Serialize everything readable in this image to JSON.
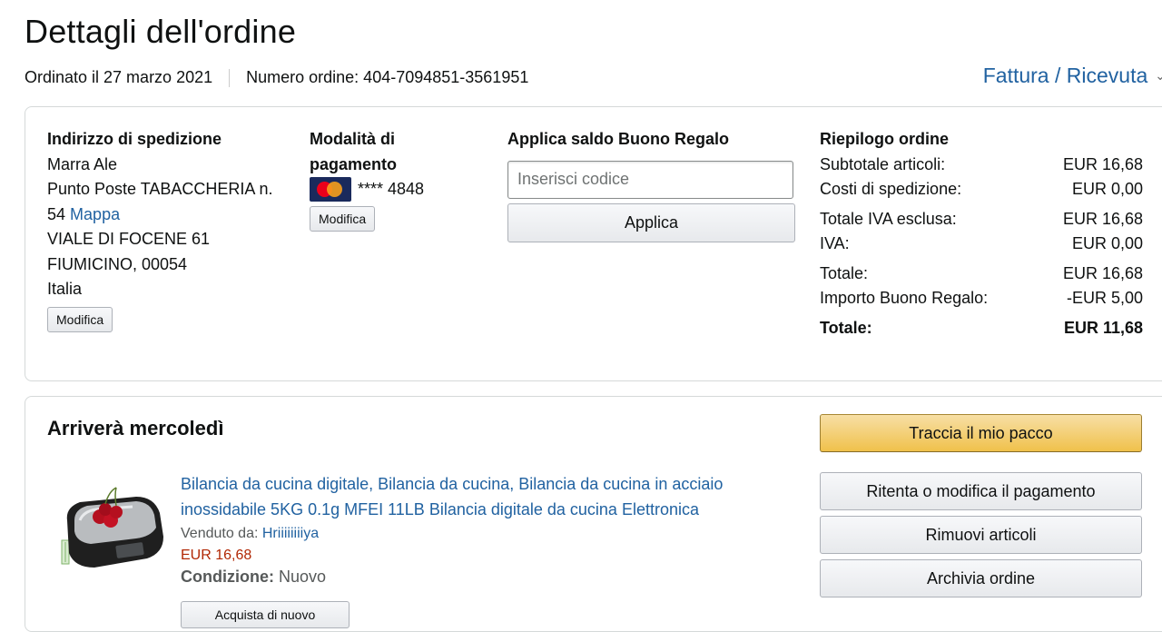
{
  "page": {
    "title": "Dettagli dell'ordine",
    "ordered_on": "Ordinato il 27 marzo 2021",
    "order_number": "Numero ordine: 404-7094851-3561951",
    "invoice_link": "Fattura / Ricevuta"
  },
  "shipping": {
    "heading": "Indirizzo di spedizione",
    "name": "Marra Ale",
    "line1": "Punto Poste TABACCHERIA n.",
    "line2": "54",
    "map_link": "Mappa",
    "line3": "VIALE DI FOCENE 61",
    "line4": "FIUMICINO, 00054",
    "line5": "Italia",
    "edit_label": "Modifica"
  },
  "payment": {
    "heading": "Modalità di pagamento",
    "card_masked": "**** 4848",
    "edit_label": "Modifica"
  },
  "gift": {
    "heading": "Applica saldo Buono Regalo",
    "placeholder": "Inserisci codice",
    "apply_label": "Applica"
  },
  "summary": {
    "heading": "Riepilogo ordine",
    "rows": [
      {
        "label": "Subtotale articoli:",
        "value": "EUR 16,68"
      },
      {
        "label": "Costi di spedizione:",
        "value": "EUR 0,00"
      },
      {
        "label": "Totale IVA esclusa:",
        "value": "EUR 16,68"
      },
      {
        "label": "IVA:",
        "value": "EUR 0,00"
      },
      {
        "label": "Totale:",
        "value": "EUR 16,68"
      },
      {
        "label": "Importo Buono Regalo:",
        "value": "-EUR 5,00"
      }
    ],
    "grand_total_label": "Totale:",
    "grand_total_value": "EUR 11,68"
  },
  "shipment": {
    "title": "Arriverà mercoledì",
    "product": {
      "title": "Bilancia da cucina digitale, Bilancia da cucina, Bilancia da cucina in acciaio inossidabile 5KG 0.1g MFEI 11LB Bilancia digitale da cucina Elettronica",
      "sold_by_label": "Venduto da:",
      "seller": "Hriiiiiiiiya",
      "price": "EUR 16,68",
      "condition_label": "Condizione:",
      "condition_value": "Nuovo",
      "rebuy_label": "Acquista di nuovo"
    },
    "actions": {
      "track": "Traccia il mio pacco",
      "retry_payment": "Ritenta o modifica il pagamento",
      "remove_items": "Rimuovi articoli",
      "archive": "Archivia ordine"
    }
  },
  "colors": {
    "link": "#2162a1",
    "price": "#b12704",
    "primary_button": "#f0c14b"
  }
}
